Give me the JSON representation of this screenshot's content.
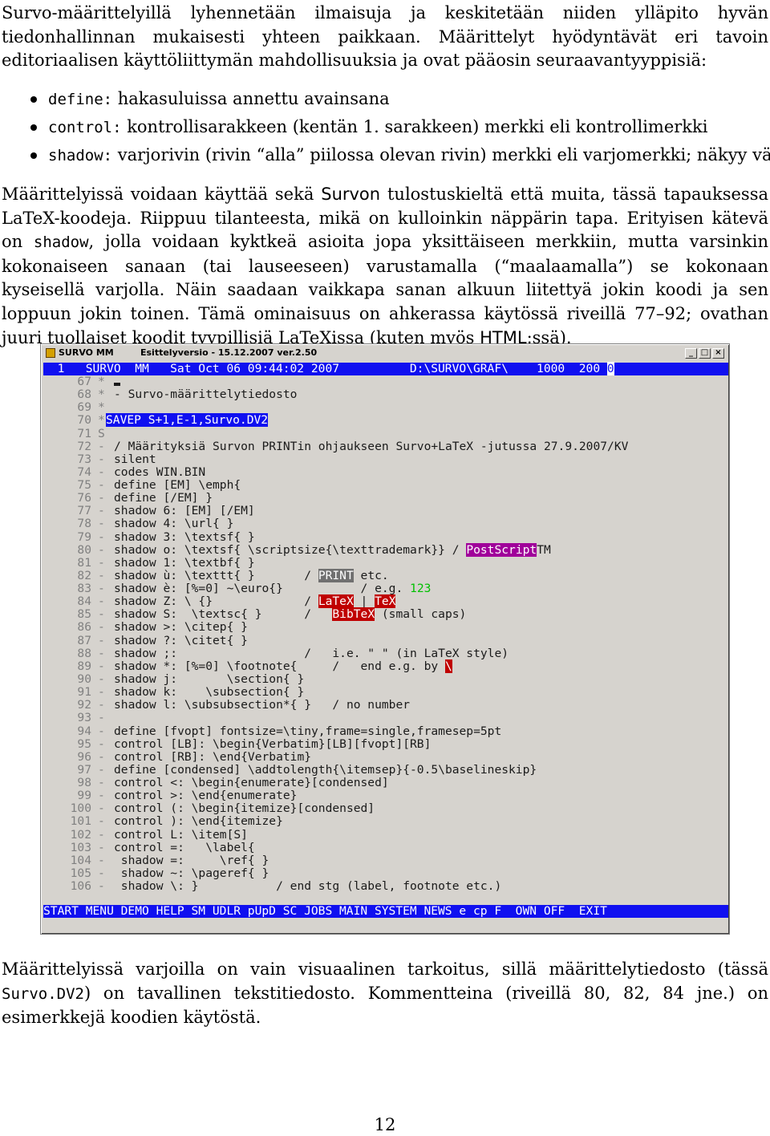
{
  "intro": {
    "p1": "Survo-määrittelyillä lyhennetään ilmaisuja ja keskitetään niiden ylläpito hyvän tiedonhallinnan mukaisesti yhteen paikkaan. Määrittelyt hyödyntävät eri tavoin editoriaalisen käyttöliittymän mahdollisuuksia ja ovat pääosin seuraavantyyppisiä:",
    "bullets": [
      {
        "code": "define:",
        "text": " hakasuluissa annettu avainsana"
      },
      {
        "code": "control:",
        "text": " kontrollisarakkeen (kentän 1. sarakkeen) merkki eli kontrollimerkki"
      },
      {
        "code": "shadow:",
        "text": " varjorivin (rivin “alla” piilossa olevan rivin) merkki eli varjomerkki; näkyy värinä"
      }
    ]
  },
  "para2": {
    "a": "Määrittelyissä voidaan käyttää sekä ",
    "survo": "Survon",
    "b": " tulostuskieltä että muita, tässä tapauksessa ",
    "latex": "LaTeX",
    "c": "-koodeja. Riippuu tilanteesta, mikä on kulloinkin näppärin tapa. Erityisen kätevä on ",
    "shadow": "shadow",
    "d": ", jolla voidaan kyktkeä asioita jopa yksittäiseen merkkiin, mutta varsinkin kokonaiseen sanaan (tai lauseeseen) varustamalla (“maalaamalla”) se kokonaan kyseisellä varjolla. Näin saadaan vaikkapa sanan alkuun liitettyä jokin koodi ja sen loppuun jokin toinen. Tämä ominaisuus on ahkerassa käytössä riveillä 77–92; ovathan juuri tuollaiset koodit tyypillisiä ",
    "latex2": "LaTeX",
    "e": "issa (kuten myös ",
    "html": "HTML",
    "f": ":ssä)."
  },
  "window": {
    "title_app": "SURVO MM",
    "title_version": "Esittelyversio - 15.12.2007 ver.2.50",
    "header": "  1   SURVO  MM   Sat Oct 06 09:44:02 2007          D:\\SURVO\\GRAF\\    1000  200 ",
    "header_tail": "0",
    "lines": [
      {
        "n": "67",
        "c": "*",
        "t": ""
      },
      {
        "n": "68",
        "c": "*",
        "t": "- Survo-määrittelytiedosto"
      },
      {
        "n": "69",
        "c": "*",
        "t": ""
      },
      {
        "n": "70",
        "c": "*",
        "t": "SAVEP S+1,E-1,Survo.DV2"
      },
      {
        "n": "71",
        "c": "S",
        "t": ""
      },
      {
        "n": "72",
        "c": "-",
        "t": "/ Määrityksiä Survon PRINTin ohjaukseen Survo+LaTeX -jutussa 27.9.2007/KV"
      },
      {
        "n": "73",
        "c": "-",
        "t": "silent"
      },
      {
        "n": "74",
        "c": "-",
        "t": "codes WIN.BIN"
      },
      {
        "n": "75",
        "c": "-",
        "t": "define [EM] \\emph{"
      },
      {
        "n": "76",
        "c": "-",
        "t": "define [/EM] }"
      },
      {
        "n": "77",
        "c": "-",
        "t": "shadow 6: [EM] [/EM]"
      },
      {
        "n": "78",
        "c": "-",
        "t": "shadow 4: \\url{ }"
      },
      {
        "n": "79",
        "c": "-",
        "t": "shadow 3: \\textsf{ }"
      },
      {
        "n": "80",
        "c": "-",
        "t": "shadow o: \\textsf{ \\scriptsize{\\texttrademark}} / "
      },
      {
        "n": "81",
        "c": "-",
        "t": "shadow 1: \\textbf{ }"
      },
      {
        "n": "82",
        "c": "-",
        "t": "shadow ù: \\texttt{ }       / "
      },
      {
        "n": "83",
        "c": "-",
        "t": "shadow è: [%=0] ~\\euro{}"
      },
      {
        "n": "84",
        "c": "-",
        "t": "shadow Z: \\ {}             / "
      },
      {
        "n": "85",
        "c": "-",
        "t": "shadow S:  \\textsc{ }      / "
      },
      {
        "n": "86",
        "c": "-",
        "t": "shadow >: \\citep{ }"
      },
      {
        "n": "87",
        "c": "-",
        "t": "shadow ?: \\citet{ }"
      },
      {
        "n": "88",
        "c": "-",
        "t": "shadow ;:                  /   i.e. \" \" (in LaTeX style)"
      },
      {
        "n": "89",
        "c": "-",
        "t": "shadow *: [%=0] \\footnote{     /   end e.g. by "
      },
      {
        "n": "90",
        "c": "-",
        "t": "shadow j:       \\section{ }"
      },
      {
        "n": "91",
        "c": "-",
        "t": "shadow k:    \\subsection{ }"
      },
      {
        "n": "92",
        "c": "-",
        "t": "shadow l: \\subsubsection*{ }   / no number"
      },
      {
        "n": "93",
        "c": "-",
        "t": ""
      },
      {
        "n": "94",
        "c": "-",
        "t": "define [fvopt] fontsize=\\tiny,frame=single,framesep=5pt"
      },
      {
        "n": "95",
        "c": "-",
        "t": "control [LB]: \\begin{Verbatim}[LB][fvopt][RB]"
      },
      {
        "n": "96",
        "c": "-",
        "t": "control [RB]: \\end{Verbatim}"
      },
      {
        "n": "97",
        "c": "-",
        "t": "define [condensed] \\addtolength{\\itemsep}{-0.5\\baselineskip}"
      },
      {
        "n": "98",
        "c": "-",
        "t": "control <: \\begin{enumerate}[condensed]"
      },
      {
        "n": "99",
        "c": "-",
        "t": "control >: \\end{enumerate}"
      },
      {
        "n": "100",
        "c": "-",
        "t": "control (: \\begin{itemize}[condensed]"
      },
      {
        "n": "101",
        "c": "-",
        "t": "control ): \\end{itemize}"
      },
      {
        "n": "102",
        "c": "-",
        "t": "control L: \\item[S]"
      },
      {
        "n": "103",
        "c": "-",
        "t": "control =:   \\label{"
      },
      {
        "n": "104",
        "c": "-",
        "t": " shadow =:     \\ref{ }"
      },
      {
        "n": "105",
        "c": "-",
        "t": " shadow ~: \\pageref{ }"
      },
      {
        "n": "106",
        "c": "-",
        "t": " shadow \\: }           / end stg (label, footnote etc.)"
      }
    ],
    "hl": {
      "postscript": "PostScript",
      "tm": "TM",
      "print": "PRINT",
      "etc": " etc.",
      "eg": "/ e.g. ",
      "n123": "123",
      "latex": "LaTeX",
      "bar": " | ",
      "tex": "TeX",
      "bibtex": "BibTeX",
      "smallcaps": " (small caps)",
      "quote_marks": "ʼ ʼ",
      "quote_marks2": "` `",
      "backslash": "\\"
    },
    "bottom": "START MENU DEMO HELP SM UDLR pUpD SC JOBS MAIN SYSTEM NEWS e cp F  OWN OFF  EXIT"
  },
  "para3": {
    "a": "Määrittelyissä varjoilla on vain visuaalinen tarkoitus, sillä määrittelytiedosto (tässä ",
    "file": "Survo.DV2",
    "b": ") on tavallinen tekstitiedosto. Kommentteina (riveillä 80, 82, 84 jne.) on esimerkkejä koodien käytöstä."
  },
  "page_number": "12"
}
